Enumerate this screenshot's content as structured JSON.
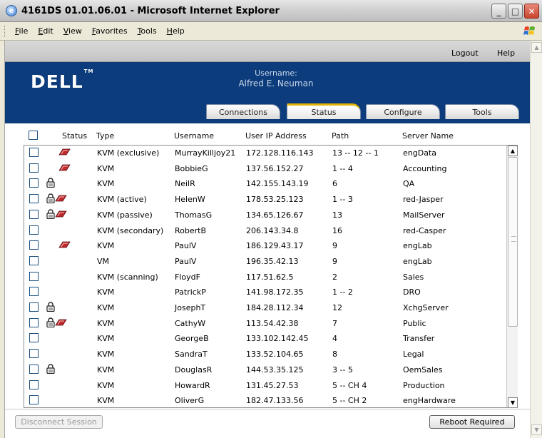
{
  "window": {
    "title": "4161DS 01.01.06.01 - Microsoft Internet Explorer",
    "app_icon": "ie-icon",
    "min_glyph": "_",
    "max_glyph": "□",
    "close_glyph": "✕"
  },
  "menu": [
    "File",
    "Edit",
    "View",
    "Favorites",
    "Tools",
    "Help"
  ],
  "topbar": {
    "logout": "Logout",
    "help": "Help"
  },
  "banner": {
    "logo": "DELL",
    "logo_tm": "TM",
    "username_label": "Username:",
    "username": "Alfred E. Neuman"
  },
  "tabs": [
    {
      "label": "Connections",
      "active": false
    },
    {
      "label": "Status",
      "active": true
    },
    {
      "label": "Configure",
      "active": false
    },
    {
      "label": "Tools",
      "active": false
    }
  ],
  "table": {
    "headers": {
      "status": "Status",
      "type": "Type",
      "username": "Username",
      "ip": "User IP Address",
      "path": "Path",
      "server": "Server Name"
    },
    "rows": [
      {
        "lock": false,
        "key": true,
        "type": "KVM (exclusive)",
        "username": "MurrayKilljoy21",
        "ip": "172.128.116.143",
        "path": "13 -- 12 -- 1",
        "server": "engData"
      },
      {
        "lock": false,
        "key": true,
        "type": "KVM",
        "username": "BobbieG",
        "ip": "137.56.152.27",
        "path": "1 -- 4",
        "server": "Accounting"
      },
      {
        "lock": true,
        "key": false,
        "type": "KVM",
        "username": "NeilR",
        "ip": "142.155.143.19",
        "path": "6",
        "server": "QA"
      },
      {
        "lock": true,
        "key": true,
        "type": "KVM (active)",
        "username": "HelenW",
        "ip": "178.53.25.123",
        "path": "1 -- 3",
        "server": "red-Jasper"
      },
      {
        "lock": true,
        "key": true,
        "type": "KVM (passive)",
        "username": "ThomasG",
        "ip": "134.65.126.67",
        "path": "13",
        "server": "MailServer"
      },
      {
        "lock": false,
        "key": false,
        "type": "KVM (secondary)",
        "username": "RobertB",
        "ip": "206.143.34.8",
        "path": "16",
        "server": "red-Casper"
      },
      {
        "lock": false,
        "key": true,
        "type": "KVM",
        "username": "PaulV",
        "ip": "186.129.43.17",
        "path": "9",
        "server": "engLab"
      },
      {
        "lock": false,
        "key": false,
        "type": "VM",
        "username": "PaulV",
        "ip": "196.35.42.13",
        "path": "9",
        "server": "engLab"
      },
      {
        "lock": false,
        "key": false,
        "type": "KVM (scanning)",
        "username": "FloydF",
        "ip": "117.51.62.5",
        "path": "2",
        "server": "Sales"
      },
      {
        "lock": false,
        "key": false,
        "type": "KVM",
        "username": "PatrickP",
        "ip": "141.98.172.35",
        "path": "1 -- 2",
        "server": "DRO"
      },
      {
        "lock": true,
        "key": false,
        "type": "KVM",
        "username": "JosephT",
        "ip": "184.28.112.34",
        "path": "12",
        "server": "XchgServer"
      },
      {
        "lock": true,
        "key": true,
        "type": "KVM",
        "username": "CathyW",
        "ip": "113.54.42.38",
        "path": "7",
        "server": "Public"
      },
      {
        "lock": false,
        "key": false,
        "type": "KVM",
        "username": "GeorgeB",
        "ip": "133.102.142.45",
        "path": "4",
        "server": "Transfer"
      },
      {
        "lock": false,
        "key": false,
        "type": "KVM",
        "username": "SandraT",
        "ip": "133.52.104.65",
        "path": "8",
        "server": "Legal"
      },
      {
        "lock": true,
        "key": false,
        "type": "KVM",
        "username": "DouglasR",
        "ip": "144.53.35.125",
        "path": "3 -- 5",
        "server": "OemSales"
      },
      {
        "lock": false,
        "key": false,
        "type": "KVM",
        "username": "HowardR",
        "ip": "131.45.27.53",
        "path": "5 -- CH 4",
        "server": "Production"
      },
      {
        "lock": false,
        "key": false,
        "type": "KVM",
        "username": "OliverG",
        "ip": "182.47.133.56",
        "path": "5 -- CH 2",
        "server": "engHardware"
      }
    ]
  },
  "buttons": {
    "disconnect": "Disconnect Session",
    "reboot": "Reboot Required"
  },
  "colors": {
    "banner": "#0c3c7b",
    "active_tab_accent": "#e0b200",
    "key_icon": "#c0282d"
  }
}
